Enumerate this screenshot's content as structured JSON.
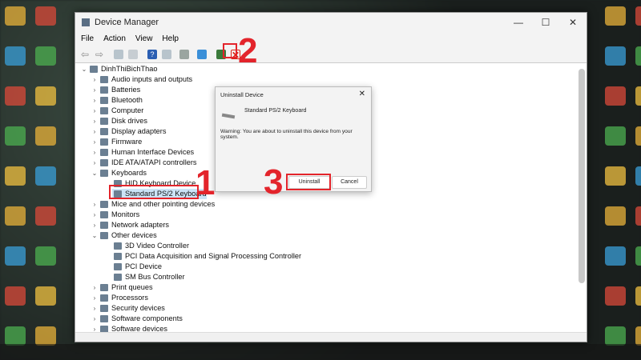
{
  "window": {
    "title": "Device Manager",
    "controls": [
      "—",
      "☐",
      "✕"
    ]
  },
  "menu": [
    "File",
    "Action",
    "View",
    "Help"
  ],
  "toolbar": {
    "icons": [
      "back-icon",
      "forward-icon",
      "properties-icon",
      "window-icon",
      "help-icon",
      "view-icon",
      "scan-icon",
      "monitor-icon",
      "enable-device-icon",
      "uninstall-device-icon"
    ]
  },
  "tree": {
    "root": "DinhThiBichThao",
    "items": [
      {
        "label": "Audio inputs and outputs",
        "level": 1
      },
      {
        "label": "Batteries",
        "level": 1
      },
      {
        "label": "Bluetooth",
        "level": 1
      },
      {
        "label": "Computer",
        "level": 1
      },
      {
        "label": "Disk drives",
        "level": 1
      },
      {
        "label": "Display adapters",
        "level": 1
      },
      {
        "label": "Firmware",
        "level": 1
      },
      {
        "label": "Human Interface Devices",
        "level": 1
      },
      {
        "label": "IDE ATA/ATAPI controllers",
        "level": 1
      },
      {
        "label": "Keyboards",
        "level": 1,
        "expanded": true
      },
      {
        "label": "HID Keyboard Device",
        "level": 2
      },
      {
        "label": "Standard PS/2 Keyboard",
        "level": 2,
        "selected": true
      },
      {
        "label": "Mice and other pointing devices",
        "level": 1
      },
      {
        "label": "Monitors",
        "level": 1
      },
      {
        "label": "Network adapters",
        "level": 1
      },
      {
        "label": "Other devices",
        "level": 1,
        "expanded": true
      },
      {
        "label": "3D Video Controller",
        "level": 2
      },
      {
        "label": "PCI Data Acquisition and Signal Processing Controller",
        "level": 2
      },
      {
        "label": "PCI Device",
        "level": 2
      },
      {
        "label": "SM Bus Controller",
        "level": 2
      },
      {
        "label": "Print queues",
        "level": 1
      },
      {
        "label": "Processors",
        "level": 1
      },
      {
        "label": "Security devices",
        "level": 1
      },
      {
        "label": "Software components",
        "level": 1
      },
      {
        "label": "Software devices",
        "level": 1
      }
    ]
  },
  "dialog": {
    "title": "Uninstall Device",
    "close": "✕",
    "device": "Standard PS/2 Keyboard",
    "warning": "Warning: You are about to uninstall this device from your system.",
    "uninstall": "Uninstall",
    "cancel": "Cancel"
  },
  "steps": [
    "1",
    "2",
    "3"
  ],
  "accent": "#e3242b"
}
